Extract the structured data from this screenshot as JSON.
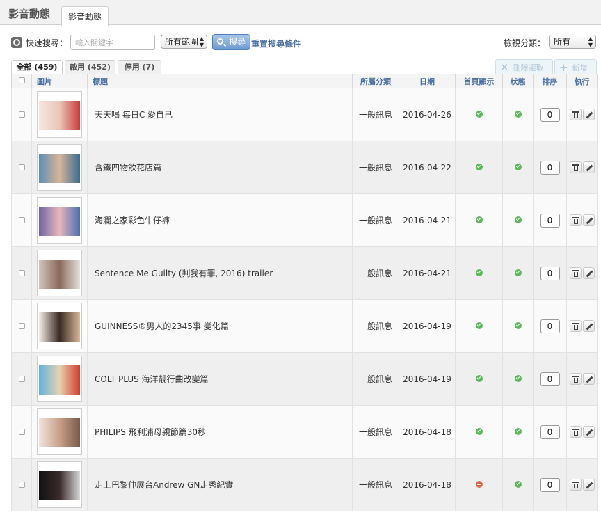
{
  "app": {
    "title": "影音動態",
    "tab_label": "影音動態"
  },
  "search": {
    "label": "快速搜尋：",
    "placeholder": "輸入關鍵字",
    "value": "",
    "scope": "所有範圍",
    "button_label": "搜尋",
    "reset_label": "重置搜尋條件",
    "view_label": "檢視分類：",
    "view_value": "所有"
  },
  "tabs": [
    {
      "label": "全部 (459)"
    },
    {
      "label": "啟用 (452)"
    },
    {
      "label": "停用 (7)"
    }
  ],
  "actions": {
    "delete_selected": "刪除選取",
    "add_new": "新增"
  },
  "table": {
    "headers": {
      "image": "圖片",
      "title": "標題",
      "category": "所屬分類",
      "date": "日期",
      "homepage": "首頁顯示",
      "status": "狀態",
      "order": "排序",
      "execute": "執行"
    },
    "rows": [
      {
        "title": "天天喝 每日C 愛自己",
        "category": "一般訊息",
        "date": "2016-04-26",
        "homepage": "shown",
        "status": "enabled",
        "order": "0"
      },
      {
        "title": "含鐵四物飲花店篇",
        "category": "一般訊息",
        "date": "2016-04-22",
        "homepage": "shown",
        "status": "enabled",
        "order": "0"
      },
      {
        "title": "海瀾之家彩色牛仔褲",
        "category": "一般訊息",
        "date": "2016-04-21",
        "homepage": "shown",
        "status": "enabled",
        "order": "0"
      },
      {
        "title": "Sentence Me Guilty (判我有罪, 2016) trailer",
        "category": "一般訊息",
        "date": "2016-04-21",
        "homepage": "shown",
        "status": "enabled",
        "order": "0"
      },
      {
        "title": "GUINNESS®男人的2345事 變化篇",
        "category": "一般訊息",
        "date": "2016-04-19",
        "homepage": "shown",
        "status": "enabled",
        "order": "0"
      },
      {
        "title": "COLT PLUS 海洋靓行曲改變篇",
        "category": "一般訊息",
        "date": "2016-04-19",
        "homepage": "shown",
        "status": "enabled",
        "order": "0"
      },
      {
        "title": "PHILIPS 飛利浦母親節篇30秒",
        "category": "一般訊息",
        "date": "2016-04-18",
        "homepage": "shown",
        "status": "enabled",
        "order": "0"
      },
      {
        "title": "走上巴黎伸展台Andrew GN走秀紀實",
        "category": "一般訊息",
        "date": "2016-04-18",
        "homepage": "hidden",
        "status": "enabled",
        "order": "0"
      }
    ]
  },
  "colors": {
    "accent": "#4a6fa5",
    "status_ok": "#5db85d",
    "status_off": "#e46446",
    "search_button": "#6e9ad1",
    "thumbnails": [
      [
        "#f6e6e0",
        "#e8c6b8",
        "#c93a3a"
      ],
      [
        "#5a8fb7",
        "#d8b496",
        "#3a6d92"
      ],
      [
        "#6e64a8",
        "#e8b7b9",
        "#4b6fb3"
      ],
      [
        "#cfc6be",
        "#8a6a5a",
        "#e4e0dc"
      ],
      [
        "#f4eee8",
        "#3a2a24",
        "#d9b89a"
      ],
      [
        "#5eb3dc",
        "#e6d2b0",
        "#d23c2c"
      ],
      [
        "#f0e4dc",
        "#c9a08a",
        "#7a5a4a"
      ],
      [
        "#111111",
        "#3a2b2b",
        "#d8d8d8"
      ]
    ]
  },
  "icons": {
    "search": "search-icon",
    "delete_selected": "close-x-icon",
    "add_new": "plus-icon",
    "homepage_shown": "check-circle-icon",
    "homepage_hidden": "minus-circle-icon",
    "delete_row": "trash-icon",
    "edit_row": "pencil-icon"
  }
}
